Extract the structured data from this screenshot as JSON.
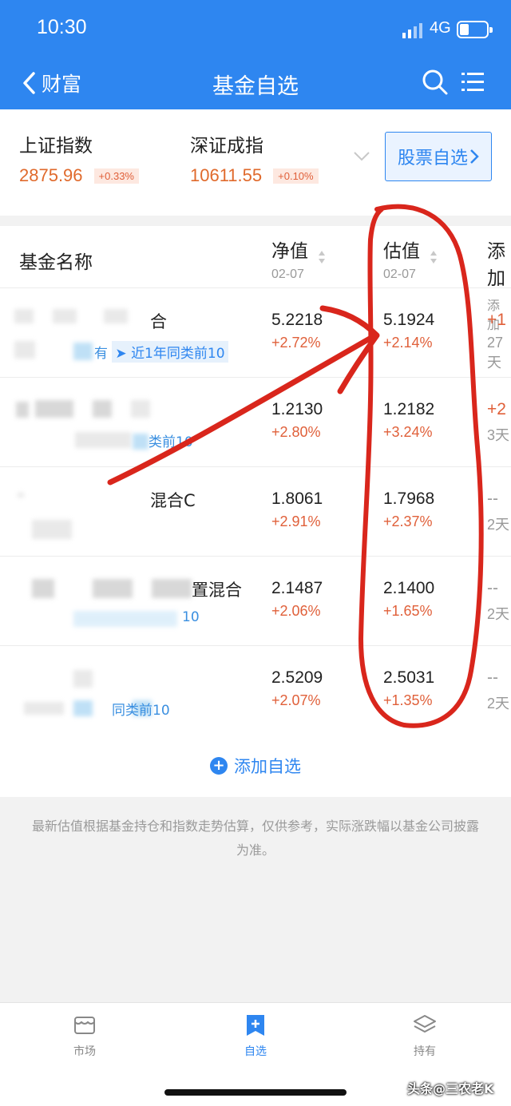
{
  "status_bar": {
    "time": "10:30",
    "network": "4G"
  },
  "nav": {
    "back_label": "财富",
    "title": "基金自选"
  },
  "indices": [
    {
      "name": "上证指数",
      "value": "2875.96",
      "change": "+0.33%"
    },
    {
      "name": "深证成指",
      "value": "10611.55",
      "change": "+0.10%"
    }
  ],
  "stock_watch_label": "股票自选",
  "table": {
    "col_name": "基金名称",
    "col_nav": {
      "label": "净值",
      "date": "02-07"
    },
    "col_est": {
      "label": "估值",
      "date": "02-07"
    },
    "col_add": {
      "label": "添加",
      "date": "添加"
    },
    "rows": [
      {
        "name_tail": "合",
        "tag": "有",
        "badge": "近1年同类前10",
        "nav": "5.2218",
        "nav_chg": "+2.72%",
        "est": "5.1924",
        "est_chg": "+2.14%",
        "add_val": "+1",
        "add_sub": "27天"
      },
      {
        "name_tail": "",
        "tag": "类前10",
        "badge": "",
        "nav": "1.2130",
        "nav_chg": "+2.80%",
        "est": "1.2182",
        "est_chg": "+3.24%",
        "add_val": "+2",
        "add_sub": "3天"
      },
      {
        "name_tail": "混合C",
        "tag": "",
        "badge": "",
        "nav": "1.8061",
        "nav_chg": "+2.91%",
        "est": "1.7968",
        "est_chg": "+2.37%",
        "add_val": "--",
        "add_sub": "2天"
      },
      {
        "name_tail": "置混合",
        "tag": "10",
        "badge": "",
        "nav": "2.1487",
        "nav_chg": "+2.06%",
        "est": "2.1400",
        "est_chg": "+1.65%",
        "add_val": "--",
        "add_sub": "2天"
      },
      {
        "name_tail": "",
        "tag": "同类前10",
        "badge": "",
        "nav": "2.5209",
        "nav_chg": "+2.07%",
        "est": "2.5031",
        "est_chg": "+1.35%",
        "add_val": "--",
        "add_sub": "2天"
      }
    ]
  },
  "add_watch_label": "添加自选",
  "disclaimer": "最新估值根据基金持仓和指数走势估算，仅供参考，实际涨跌幅以基金公司披露为准。",
  "tabs": [
    {
      "label": "市场",
      "icon": "market-icon"
    },
    {
      "label": "自选",
      "icon": "watchlist-icon"
    },
    {
      "label": "持有",
      "icon": "holdings-icon"
    }
  ],
  "watermark": "头条@三农老K",
  "colors": {
    "primary": "#2e86f0",
    "up": "#e0603a",
    "annotation": "#d9261c"
  }
}
